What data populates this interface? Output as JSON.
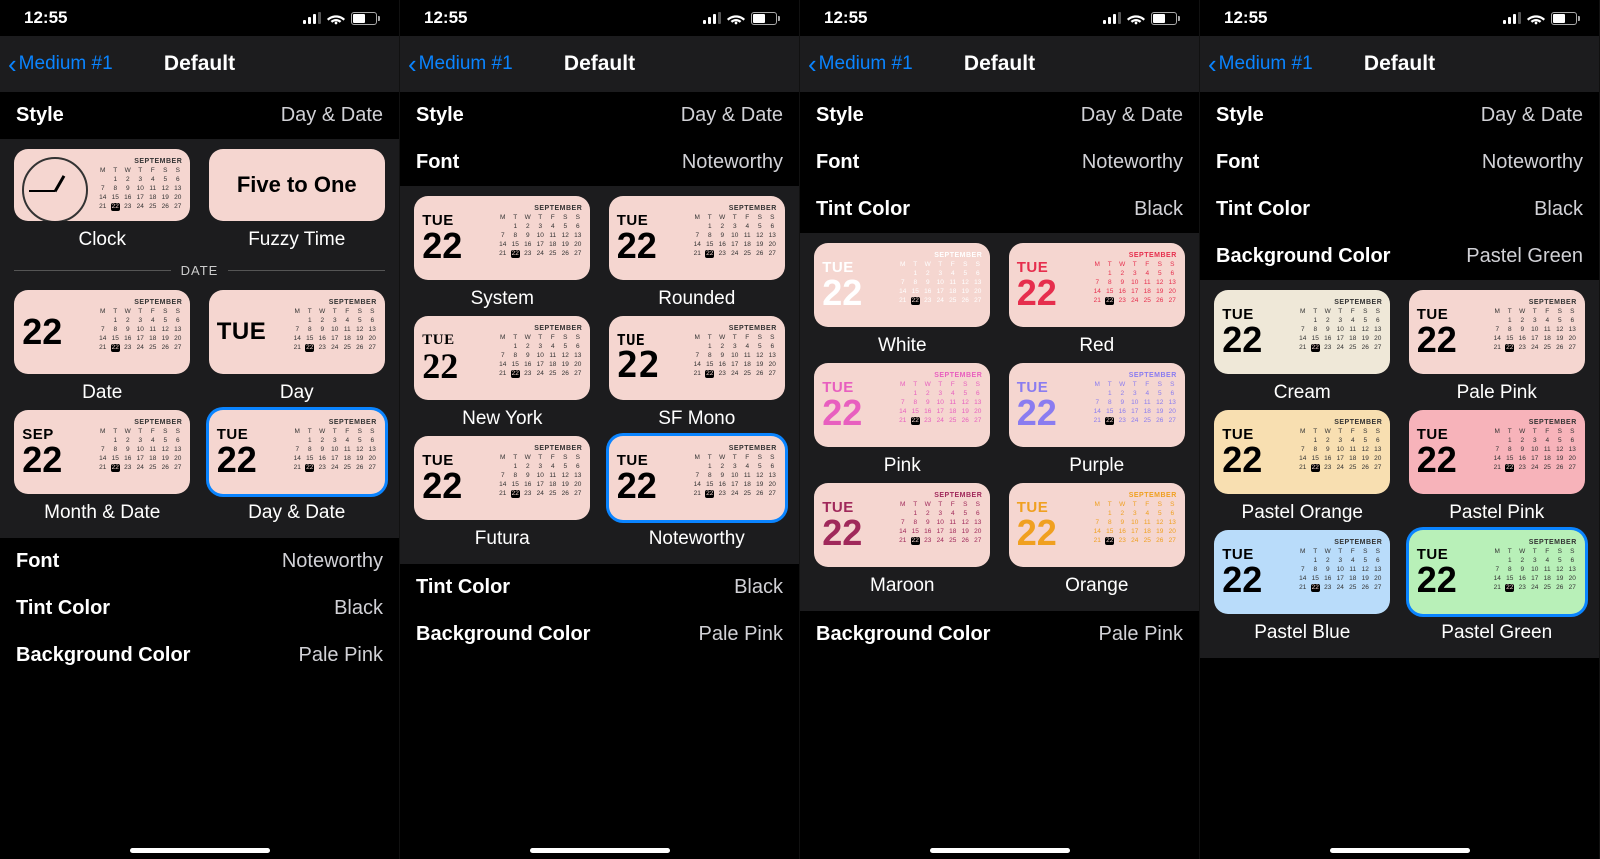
{
  "status": {
    "time": "12:55"
  },
  "nav": {
    "back": "Medium #1",
    "title": "Default"
  },
  "rows": {
    "style": {
      "label": "Style",
      "value": "Day & Date"
    },
    "font": {
      "label": "Font",
      "value": "Noteworthy"
    },
    "tint": {
      "label": "Tint Color",
      "value": "Black"
    },
    "bg_pink": {
      "label": "Background Color",
      "value": "Pale Pink"
    },
    "bg_green": {
      "label": "Background Color",
      "value": "Pastel Green"
    }
  },
  "widget": {
    "dow": "TUE",
    "daynum": "22",
    "month_abbr": "SEP",
    "month": "SEPTEMBER"
  },
  "s1": {
    "divider": "DATE",
    "items": [
      "Clock",
      "Fuzzy Time",
      "Date",
      "Day",
      "Month & Date",
      "Day & Date"
    ],
    "fuzzy": "Five to One"
  },
  "s2": {
    "items": [
      "System",
      "Rounded",
      "New York",
      "SF Mono",
      "Futura",
      "Noteworthy"
    ]
  },
  "s3": {
    "items": [
      "White",
      "Red",
      "Pink",
      "Purple",
      "Maroon",
      "Orange"
    ],
    "colors": [
      "#ffffff",
      "#e62e4d",
      "#e85fbf",
      "#8a7cf0",
      "#a0285a",
      "#f0a020"
    ]
  },
  "s4": {
    "items": [
      "Cream",
      "Pale Pink",
      "Pastel Orange",
      "Pastel Pink",
      "Pastel Blue",
      "Pastel Green"
    ]
  }
}
